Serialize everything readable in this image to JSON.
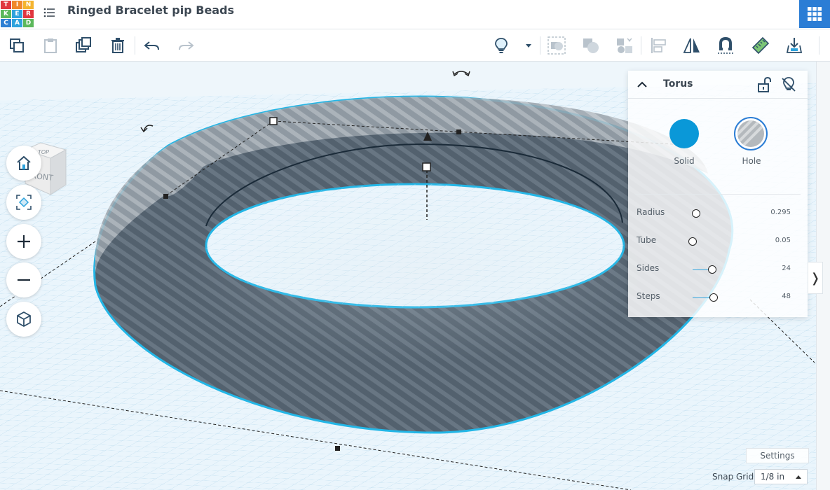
{
  "app": {
    "logo_letters": [
      "T",
      "I",
      "N",
      "K",
      "E",
      "R",
      "C",
      "A",
      "D"
    ],
    "title": "Ringed Bracelet pip Beads"
  },
  "toolbar": {
    "icons": [
      "copy-icon",
      "paste-icon",
      "duplicate-icon",
      "delete-icon",
      "undo-icon",
      "redo-icon",
      "lightbulb-icon",
      "dropdown-caret-icon",
      "group-icon",
      "ungroup-icon",
      "hole-icon",
      "align-icon",
      "mirror-icon",
      "magnet-icon",
      "ruler-icon",
      "import-icon"
    ]
  },
  "viewcube": {
    "top": "TOP",
    "front": "FRONT"
  },
  "inspector": {
    "title": "Torus",
    "solid_label": "Solid",
    "hole_label": "Hole",
    "solid_color": "#0a98d8",
    "props": [
      {
        "label": "Radius",
        "value": "0.295"
      },
      {
        "label": "Tube",
        "value": "0.05"
      },
      {
        "label": "Sides",
        "value": "24"
      },
      {
        "label": "Steps",
        "value": "48"
      }
    ]
  },
  "footer": {
    "settings_label": "Settings",
    "snap_label": "Snap Grid",
    "snap_value": "1/8 in"
  },
  "colors": {
    "accent": "#2ea3dd",
    "brand": "#2b7dd5",
    "selection_outline": "#23b6e6",
    "shape_fill": "#4e5c69"
  }
}
